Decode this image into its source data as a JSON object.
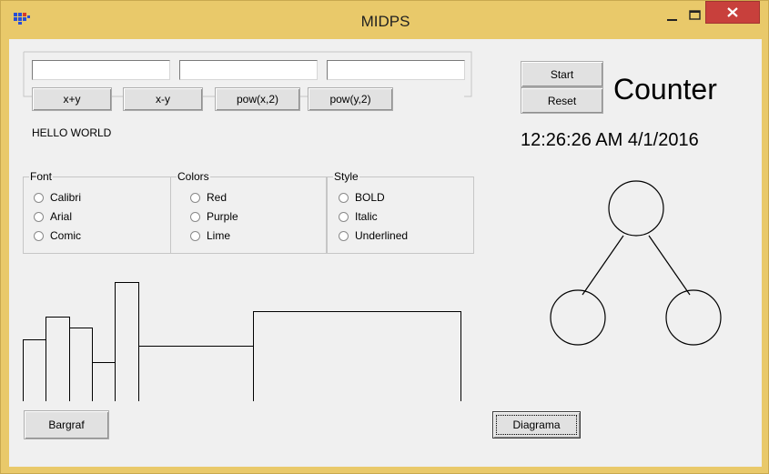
{
  "window": {
    "title": "MIDPS",
    "accent": "#e9c96a",
    "close_color": "#c8403c"
  },
  "titlebar": {
    "icons": [
      "app-icon",
      "minimize-icon",
      "maximize-icon",
      "close-icon"
    ]
  },
  "inputs": [
    {
      "value": "",
      "placeholder": ""
    },
    {
      "value": "",
      "placeholder": ""
    },
    {
      "value": "",
      "placeholder": ""
    }
  ],
  "ops": {
    "add": "x+y",
    "sub": "x-y",
    "pow_x": "pow(x,2)",
    "pow_y": "pow(y,2)"
  },
  "hello": "HELLO WORLD",
  "counter": {
    "start": "Start",
    "reset": "Reset",
    "label": "Counter"
  },
  "clock": "12:26:26 AM  4/1/2016",
  "groups": {
    "font": {
      "title": "Font",
      "options": [
        "Calibri",
        "Arial",
        "Comic"
      ]
    },
    "colors": {
      "title": "Colors",
      "options": [
        "Red",
        "Purple",
        "Lime"
      ]
    },
    "style": {
      "title": "Style",
      "options": [
        "BOLD",
        "Italic",
        "Underlined"
      ]
    }
  },
  "bargraph": {
    "button": "Bargraf"
  },
  "diagram": {
    "button": "Diagrama"
  }
}
